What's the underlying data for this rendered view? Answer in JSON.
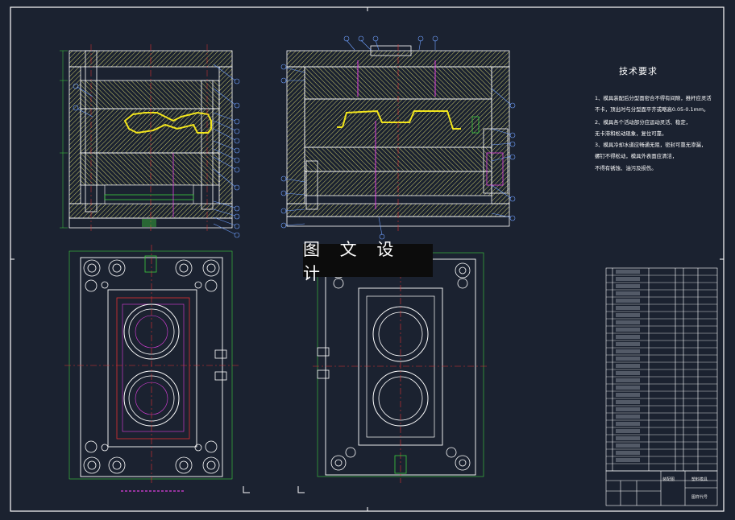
{
  "drawing": {
    "background_color": "#1b2230",
    "line_color_primary": "#ffffff",
    "hatch_color": "#d8d87a",
    "centerline_color": "#e03030",
    "leader_color": "#6fa0ff",
    "part_highlight_color": "#f2e51c",
    "magenta_color": "#e040e0",
    "green_color": "#3ecf3e"
  },
  "watermark": {
    "text": "图 文 设 计"
  },
  "technical_requirements": {
    "title": "技术要求",
    "lines": [
      "1、模具装配后分型面密合不得有间隙，推杆应灵活",
      "   不卡，顶出时与分型面平齐或略高0.05-0.1mm。",
      "2、模具各个活动部分应运动灵活、稳定，",
      "   无卡滞和松动现象，复位可靠。",
      "3、模具冷却水道应畅通无阻，密封可靠无渗漏，",
      "   螺钉不得松动，模具外表面应清洁，",
      "   不得有锈蚀、油污及损伤。"
    ]
  },
  "title_block": {
    "name_label": "装配图",
    "material_label": "塑料模具",
    "drawing_code_label": "图样代号"
  },
  "bom": {
    "rows": 28
  }
}
